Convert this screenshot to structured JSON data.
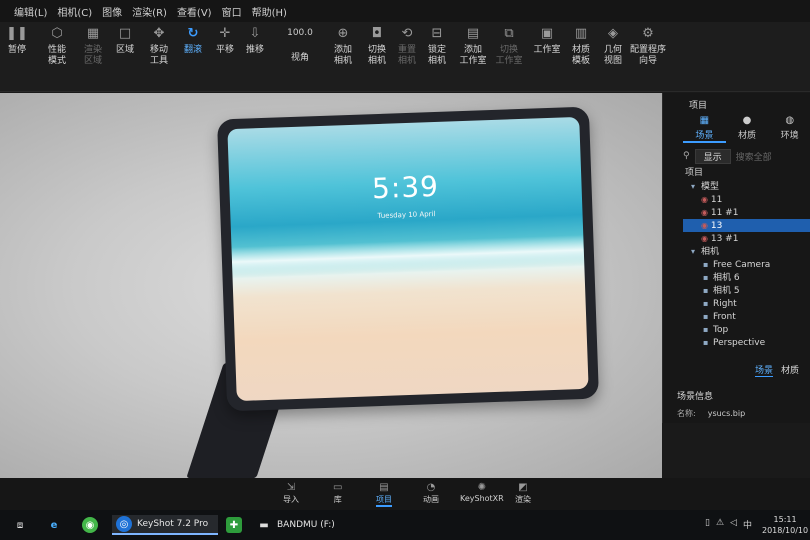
{
  "menu": [
    "编辑(E)",
    "相机(C)",
    "图像",
    "渲染(R)",
    "查看(V)",
    "窗口",
    "帮助(H)"
  ],
  "menu_partial": "编辑(L)",
  "toolbar": {
    "pause": "暂停",
    "perf_mode": "性能\n模式",
    "render_dim": "渲染\n区域",
    "region": "区域",
    "move_tool": "移动\n工具",
    "tumble": "翻滚",
    "pan": "平移",
    "dolly": "推移",
    "fov_value": "100.0",
    "fov": "视角",
    "add_camera": "添加\n相机",
    "switch_camera": "切换\n相机",
    "reset_camera": "重置\n相机",
    "lock_camera": "锁定\n相机",
    "add_workspace": "添加\n工作室",
    "switch_workspace": "切换\n工作室",
    "workspace": "工作室",
    "material_template": "材质\n模板",
    "geometry_view": "几何\n视图",
    "config_wizard": "配置程序\n向导"
  },
  "viewport": {
    "lock_time": "5:39",
    "lock_date": "Tuesday 10 April"
  },
  "panel": {
    "title": "项目",
    "tabs": [
      {
        "label": "场景",
        "icon": "scene-icon"
      },
      {
        "label": "材质",
        "icon": "material-icon"
      },
      {
        "label": "环境",
        "icon": "environment-icon"
      }
    ],
    "show_button": "显示",
    "search_placeholder": "搜索全部",
    "tree": [
      {
        "label": "项目",
        "level": 0
      },
      {
        "label": "模型",
        "level": 1
      },
      {
        "label": "11",
        "level": 2
      },
      {
        "label": "11 #1",
        "level": 2
      },
      {
        "label": "13",
        "level": 2,
        "selected": true
      },
      {
        "label": "13 #1",
        "level": 2
      },
      {
        "label": "相机",
        "level": 1
      },
      {
        "label": "Free Camera",
        "level": 2
      },
      {
        "label": "相机 6",
        "level": 2
      },
      {
        "label": "相机 5",
        "level": 2
      },
      {
        "label": "Right",
        "level": 2
      },
      {
        "label": "Front",
        "level": 2
      },
      {
        "label": "Top",
        "level": 2
      },
      {
        "label": "Perspective",
        "level": 2
      }
    ],
    "bottom_tabs": [
      "场景",
      "材质"
    ],
    "scene_info_title": "场景信息",
    "scene_name_label": "名称:",
    "scene_name_value": "ysucs.bip"
  },
  "bottom_tools": [
    {
      "label": "导入",
      "icon": "import-icon"
    },
    {
      "label": "库",
      "icon": "library-icon"
    },
    {
      "label": "项目",
      "icon": "project-icon",
      "active": true
    },
    {
      "label": "动画",
      "icon": "animation-icon"
    },
    {
      "label": "KeyShotXR",
      "icon": "keyshotxr-icon"
    },
    {
      "label": "渲染",
      "icon": "render-icon"
    }
  ],
  "taskbar": {
    "keyshot": "KeyShot 7.2 Pro",
    "drive": "BANDMU (F:)",
    "ime": "中",
    "time": "15:11",
    "date": "2018/10/10"
  }
}
